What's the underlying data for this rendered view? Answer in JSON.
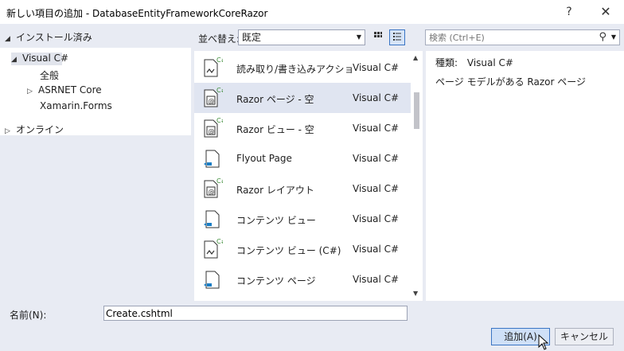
{
  "window": {
    "title": "新しい項目の追加 - DatabaseEntityFrameworkCoreRazor",
    "help": "?",
    "close": "✕"
  },
  "left": {
    "installed": "インストール済み",
    "visual_csharp": "Visual C#",
    "all": "全般",
    "aspnet_core": "ASRNET Core",
    "xamarin_forms": "Xamarin.Forms",
    "online": "オンライン"
  },
  "toolbar": {
    "sort_label": "並べ替え:",
    "sort_value": "既定"
  },
  "search": {
    "placeholder": "検索 (Ctrl+E)"
  },
  "templates": [
    {
      "name": "読み取り/書き込みアクション…",
      "lang": "Visual C#",
      "icon": "csharp-action-icon"
    },
    {
      "name": "Razor ページ - 空",
      "lang": "Visual C#",
      "icon": "razor-page-icon"
    },
    {
      "name": "Razor ビュー - 空",
      "lang": "Visual C#",
      "icon": "razor-view-icon"
    },
    {
      "name": "Flyout Page",
      "lang": "Visual C#",
      "icon": "xaml-page-icon"
    },
    {
      "name": "Razor レイアウト",
      "lang": "Visual C#",
      "icon": "razor-layout-icon"
    },
    {
      "name": "コンテンツ ビュー",
      "lang": "Visual C#",
      "icon": "xaml-view-icon"
    },
    {
      "name": "コンテンツ ビュー (C#)",
      "lang": "Visual C#",
      "icon": "csharp-view-icon"
    },
    {
      "name": "コンテンツ ページ",
      "lang": "Visual C#",
      "icon": "xaml-page-icon"
    }
  ],
  "details": {
    "type_label": "種類:",
    "type_value": "Visual C#",
    "description": "ページ モデルがある Razor ページ"
  },
  "bottom": {
    "name_label": "名前(N):",
    "name_value": "Create.cshtml",
    "add_label": "追加(A)",
    "cancel_label": "キャンセル"
  }
}
